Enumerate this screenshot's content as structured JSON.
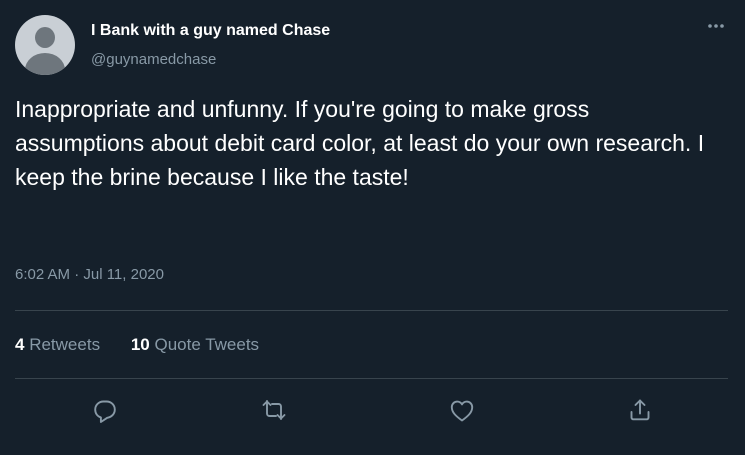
{
  "user": {
    "display_name": "I Bank with a guy named Chase",
    "handle": "@guynamedchase"
  },
  "tweet": {
    "text": "Inappropriate and unfunny. If you're going to make gross assumptions about debit card color, at least do your own research. I keep the brine because I like the taste!",
    "timestamp": "6:02 AM · Jul 11, 2020"
  },
  "stats": {
    "retweets_count": "4",
    "retweets_label": "Retweets",
    "quote_count": "10",
    "quote_label": "Quote Tweets"
  },
  "icons": {
    "more": "more-horizontal-icon",
    "reply": "reply-icon",
    "retweet": "retweet-icon",
    "like": "heart-icon",
    "share": "share-icon"
  },
  "colors": {
    "background": "#15202b",
    "text_primary": "#ffffff",
    "text_secondary": "#8899a6",
    "divider": "#38444d"
  }
}
